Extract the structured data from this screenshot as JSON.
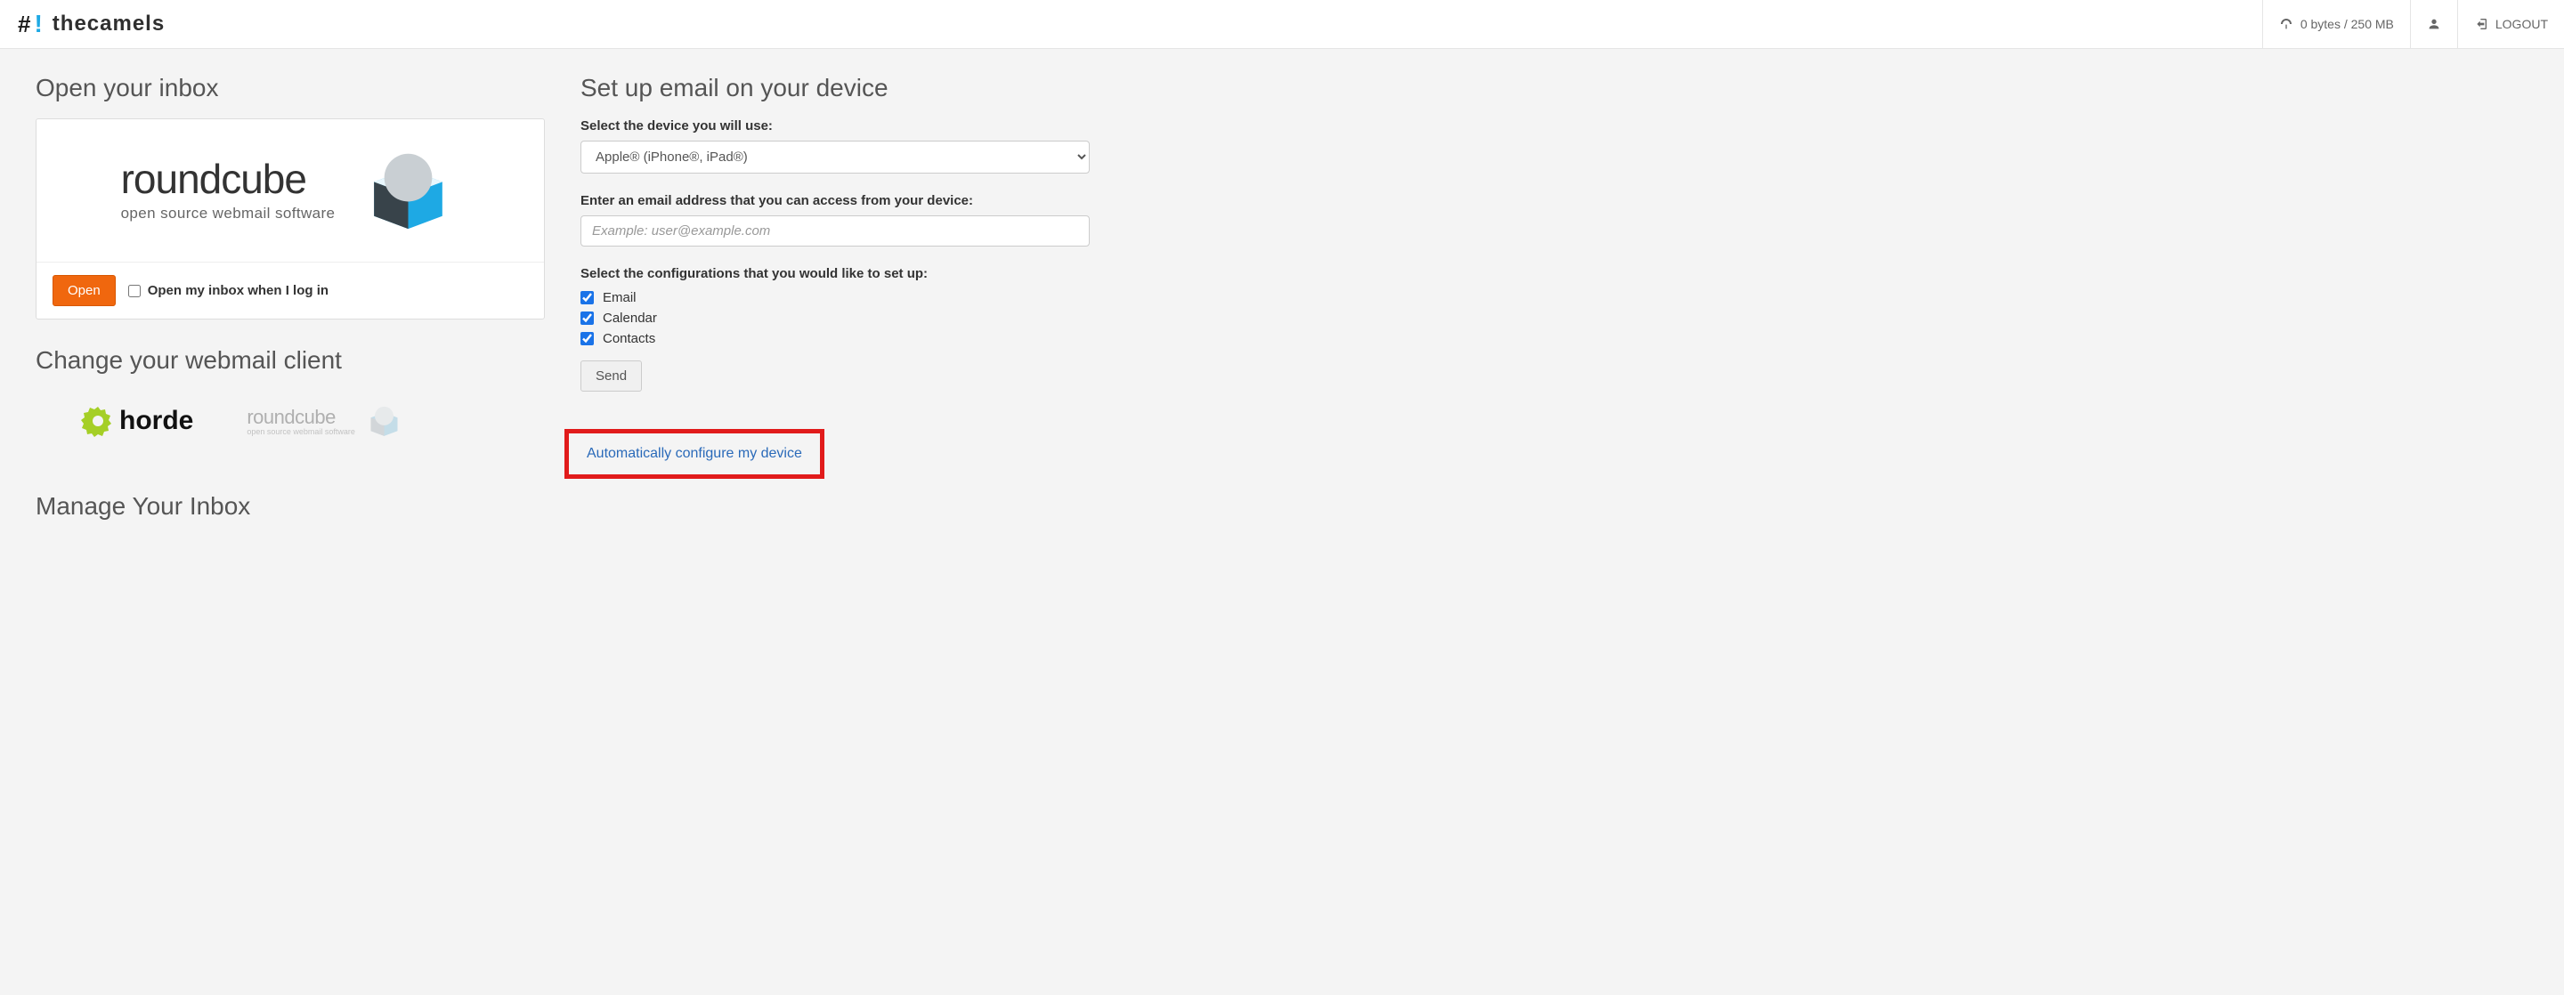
{
  "header": {
    "brand_name": "thecamels",
    "storage": "0 bytes / 250 MB",
    "logout": "LOGOUT"
  },
  "left": {
    "open_inbox_title": "Open your inbox",
    "roundcube_title": "roundcube",
    "roundcube_sub": "open source webmail software",
    "open_button": "Open",
    "open_checkbox_label": "Open my inbox when I log in",
    "change_client_title": "Change your webmail client",
    "horde_label": "horde",
    "rc_mini_title": "roundcube",
    "rc_mini_sub": "open source webmail software",
    "manage_inbox_title": "Manage Your Inbox"
  },
  "right": {
    "setup_title": "Set up email on your device",
    "device_label": "Select the device you will use:",
    "device_selected": "Apple® (iPhone®, iPad®)",
    "email_label": "Enter an email address that you can access from your device:",
    "email_placeholder": "Example: user@example.com",
    "config_label": "Select the configurations that you would like to set up:",
    "cfg_email": "Email",
    "cfg_calendar": "Calendar",
    "cfg_contacts": "Contacts",
    "send_button": "Send",
    "auto_link": "Automatically configure my device"
  }
}
